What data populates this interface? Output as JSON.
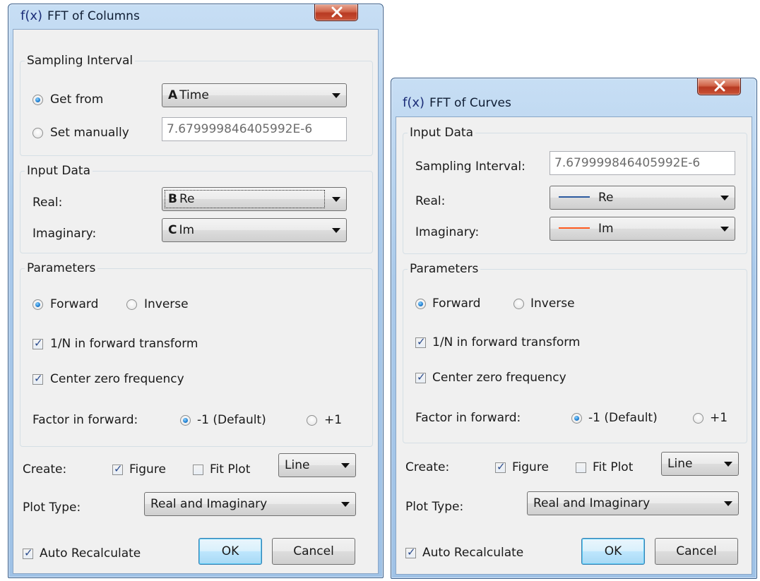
{
  "columns_dialog": {
    "title": "FFT of Columns",
    "app_icon": "f(x)",
    "sampling_interval": {
      "group_label": "Sampling Interval",
      "get_from_label": "Get from",
      "get_from_selected": true,
      "get_from_col": "A",
      "get_from_value": "Time",
      "set_manually_label": "Set manually",
      "set_manually_value": "7.679999846405992E-6"
    },
    "input_data": {
      "group_label": "Input Data",
      "real_label": "Real:",
      "real_col": "B",
      "real_value": "Re",
      "imag_label": "Imaginary:",
      "imag_col": "C",
      "imag_value": "Im"
    },
    "parameters": {
      "group_label": "Parameters",
      "forward_label": "Forward",
      "inverse_label": "Inverse",
      "one_over_n_label": "1/N in forward transform",
      "center_zero_label": "Center zero frequency",
      "factor_label": "Factor in forward:",
      "factor_default_label": "-1 (Default)",
      "factor_plus_label": "+1"
    },
    "create_label": "Create:",
    "figure_label": "Figure",
    "fit_plot_label": "Fit Plot",
    "line_value": "Line",
    "plot_type_label": "Plot Type:",
    "plot_type_value": "Real and Imaginary",
    "auto_recalc_label": "Auto Recalculate",
    "ok_label": "OK",
    "cancel_label": "Cancel"
  },
  "curves_dialog": {
    "title": "FFT of Curves",
    "app_icon": "f(x)",
    "input_data": {
      "group_label": "Input Data",
      "sampling_label": "Sampling Interval:",
      "sampling_value": "7.679999846405992E-6",
      "real_label": "Real:",
      "real_value": "Re",
      "real_color": "#2c5aa0",
      "imag_label": "Imaginary:",
      "imag_value": "Im",
      "imag_color": "#ff5a1f"
    },
    "parameters": {
      "group_label": "Parameters",
      "forward_label": "Forward",
      "inverse_label": "Inverse",
      "one_over_n_label": "1/N in forward transform",
      "center_zero_label": "Center zero frequency",
      "factor_label": "Factor in forward:",
      "factor_default_label": "-1 (Default)",
      "factor_plus_label": "+1"
    },
    "create_label": "Create:",
    "figure_label": "Figure",
    "fit_plot_label": "Fit Plot",
    "line_value": "Line",
    "plot_type_label": "Plot Type:",
    "plot_type_value": "Real and Imaginary",
    "auto_recalc_label": "Auto Recalculate",
    "ok_label": "OK",
    "cancel_label": "Cancel"
  }
}
